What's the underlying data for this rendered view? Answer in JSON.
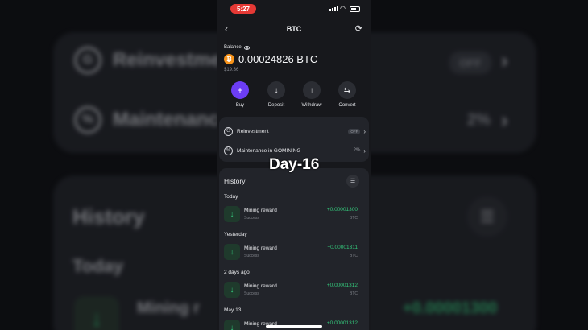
{
  "status_bar": {
    "time": "5:27"
  },
  "header": {
    "title": "BTC"
  },
  "balance": {
    "label": "Balance",
    "coin_symbol": "₿",
    "value": "0.00024826 BTC",
    "fiat": "$19.36"
  },
  "actions": [
    {
      "label": "Buy",
      "icon": "plus-icon",
      "glyph": "+"
    },
    {
      "label": "Deposit",
      "icon": "arrow-down-icon",
      "glyph": "↓"
    },
    {
      "label": "Withdraw",
      "icon": "arrow-up-icon",
      "glyph": "↑"
    },
    {
      "label": "Convert",
      "icon": "swap-icon",
      "glyph": "⇆"
    }
  ],
  "settings": {
    "reinvestment": {
      "label": "Reinvestment",
      "state": "OFF"
    },
    "maintenance": {
      "label": "Maintenance in GOMINING",
      "value": "2%"
    }
  },
  "overlay_text": "Day-16",
  "history": {
    "title": "History",
    "groups": [
      {
        "label": "Today",
        "items": [
          {
            "name": "Mining reward",
            "status": "Success",
            "amount": "+0.00001300",
            "currency": "BTC"
          }
        ]
      },
      {
        "label": "Yesterday",
        "items": [
          {
            "name": "Mining reward",
            "status": "Success",
            "amount": "+0.00001311",
            "currency": "BTC"
          }
        ]
      },
      {
        "label": "2 days ago",
        "items": [
          {
            "name": "Mining reward",
            "status": "Success",
            "amount": "+0.00001312",
            "currency": "BTC"
          }
        ]
      },
      {
        "label": "May 13",
        "items": [
          {
            "name": "Mining reward",
            "status": "",
            "amount": "+0.00001312",
            "currency": ""
          }
        ]
      }
    ]
  },
  "background_zoom": {
    "reinvestment_label": "Reinvestment",
    "off_label": "OFF",
    "maintenance_label": "Maintenance",
    "pct_label": "2%",
    "history_label": "History",
    "today_label": "Today",
    "mining_label": "Mining r",
    "amount_label": "+0.00001300"
  },
  "colors": {
    "accent": "#6c3df4",
    "positive": "#34c77b",
    "btc": "#f7931a",
    "recording": "#e53935"
  }
}
